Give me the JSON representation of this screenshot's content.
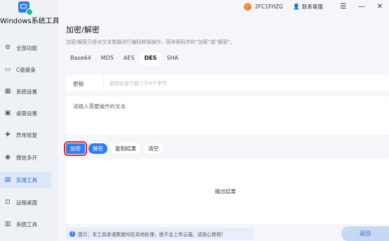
{
  "app": {
    "title": "Windows系统工具"
  },
  "sidebar": {
    "items": [
      {
        "label": "全部功能",
        "icon": "gear-icon"
      },
      {
        "label": "C盘瘦身",
        "icon": "drive-icon"
      },
      {
        "label": "系统设置",
        "icon": "grid-icon"
      },
      {
        "label": "桌面设置",
        "icon": "monitor-icon"
      },
      {
        "label": "异常修复",
        "icon": "wrench-icon"
      },
      {
        "label": "微信多开",
        "icon": "chat-icon"
      },
      {
        "label": "实用工具",
        "icon": "toolbox-icon"
      },
      {
        "label": "远程桌面",
        "icon": "remote-icon"
      },
      {
        "label": "系统工具",
        "icon": "briefcase-icon"
      }
    ],
    "active_index": 6
  },
  "topbar": {
    "user_id": "2FC1FHZG",
    "service": "联系客服"
  },
  "page": {
    "title": "加密/解密",
    "description": "加密/解密只是对文本数据进行编码转换操作，而非密码学的“加密”或“解密”。"
  },
  "tabs": [
    "Base64",
    "MD5",
    "AES",
    "DES",
    "SHA"
  ],
  "active_tab": "DES",
  "key": {
    "label": "密钥",
    "placeholder": "密钥长度不能少于8个字节"
  },
  "input": {
    "placeholder": "请输入需要操作的文本"
  },
  "buttons": {
    "encrypt": "加密",
    "decrypt": "解密",
    "copy": "复制结果",
    "clear": "清空"
  },
  "output": {
    "placeholder": "输出结果"
  },
  "notice": {
    "text": "提示：本工具承诺数据均在本地处理，绝不会上传云端，请放心使用！"
  },
  "back": "返回",
  "colors": {
    "accent": "#2f7df6",
    "highlight": "#d9262c",
    "active_nav_bg": "#dbe6f8"
  }
}
